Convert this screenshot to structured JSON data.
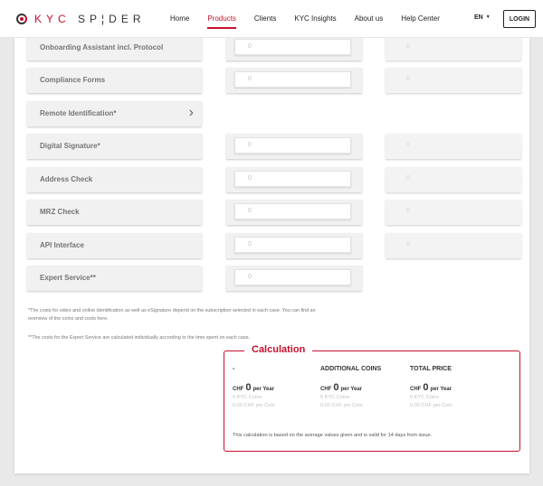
{
  "header": {
    "logo_kyc": "KYC",
    "logo_spider": "SP¦DER",
    "nav": [
      {
        "label": "Home"
      },
      {
        "label": "Products"
      },
      {
        "label": "Clients"
      },
      {
        "label": "KYC Insights"
      },
      {
        "label": "About us"
      },
      {
        "label": "Help Center"
      }
    ],
    "active_nav": "Products",
    "language": "EN",
    "login_label": "LOGIN"
  },
  "features": [
    {
      "label": "Onboarding Assistant incl. Protocol",
      "quantity": "0",
      "price": "0",
      "has_quantity": true,
      "has_price": true
    },
    {
      "label": "Compliance Forms",
      "quantity": "0",
      "price": "0",
      "has_quantity": true,
      "has_price": true
    },
    {
      "label": "Remote Identification*",
      "has_quantity": false,
      "has_price": false,
      "expandable": true
    },
    {
      "label": "Digital Signature*",
      "quantity": "0",
      "price": "0",
      "has_quantity": true,
      "has_price": true
    },
    {
      "label": "Address Check",
      "quantity": "0",
      "price": "0",
      "has_quantity": true,
      "has_price": true
    },
    {
      "label": "MRZ Check",
      "quantity": "0",
      "price": "0",
      "has_quantity": true,
      "has_price": true
    },
    {
      "label": "API Interface",
      "quantity": "0",
      "price": "0",
      "has_quantity": true,
      "has_price": true
    },
    {
      "label": "Expert Service**",
      "quantity": "0",
      "has_quantity": true,
      "has_price": false
    }
  ],
  "footnotes": {
    "note1": "*The costs for video and online identification as well as eSignature depend on the subscription selected in each case. You can find an overview of the coins and costs here.",
    "note2": "**The costs for the Expert Service are calculated individually according to the time spent on each case."
  },
  "calculation": {
    "title": "Calculation",
    "columns": [
      {
        "heading": "-",
        "currency": "CHF",
        "amount": "0",
        "period": "per Year",
        "coins": "0 KYC Coins",
        "per_coin": "0.00 CHF per Coin"
      },
      {
        "heading": "ADDITIONAL COINS",
        "currency": "CHF",
        "amount": "0",
        "period": "per Year",
        "coins": "0 KYC Coins",
        "per_coin": "0.00 CHF per Coin"
      },
      {
        "heading": "TOTAL PRICE",
        "currency": "CHF",
        "amount": "0",
        "period": "per Year",
        "coins": "0 KYC Coins",
        "per_coin": "0.00 CHF per Coin"
      }
    ],
    "note": "This calculation is based on the average values given and is valid for 14 days from issue."
  },
  "colors": {
    "accent": "#c8102e",
    "background": "#e9e9e9",
    "panel": "#ffffff"
  }
}
